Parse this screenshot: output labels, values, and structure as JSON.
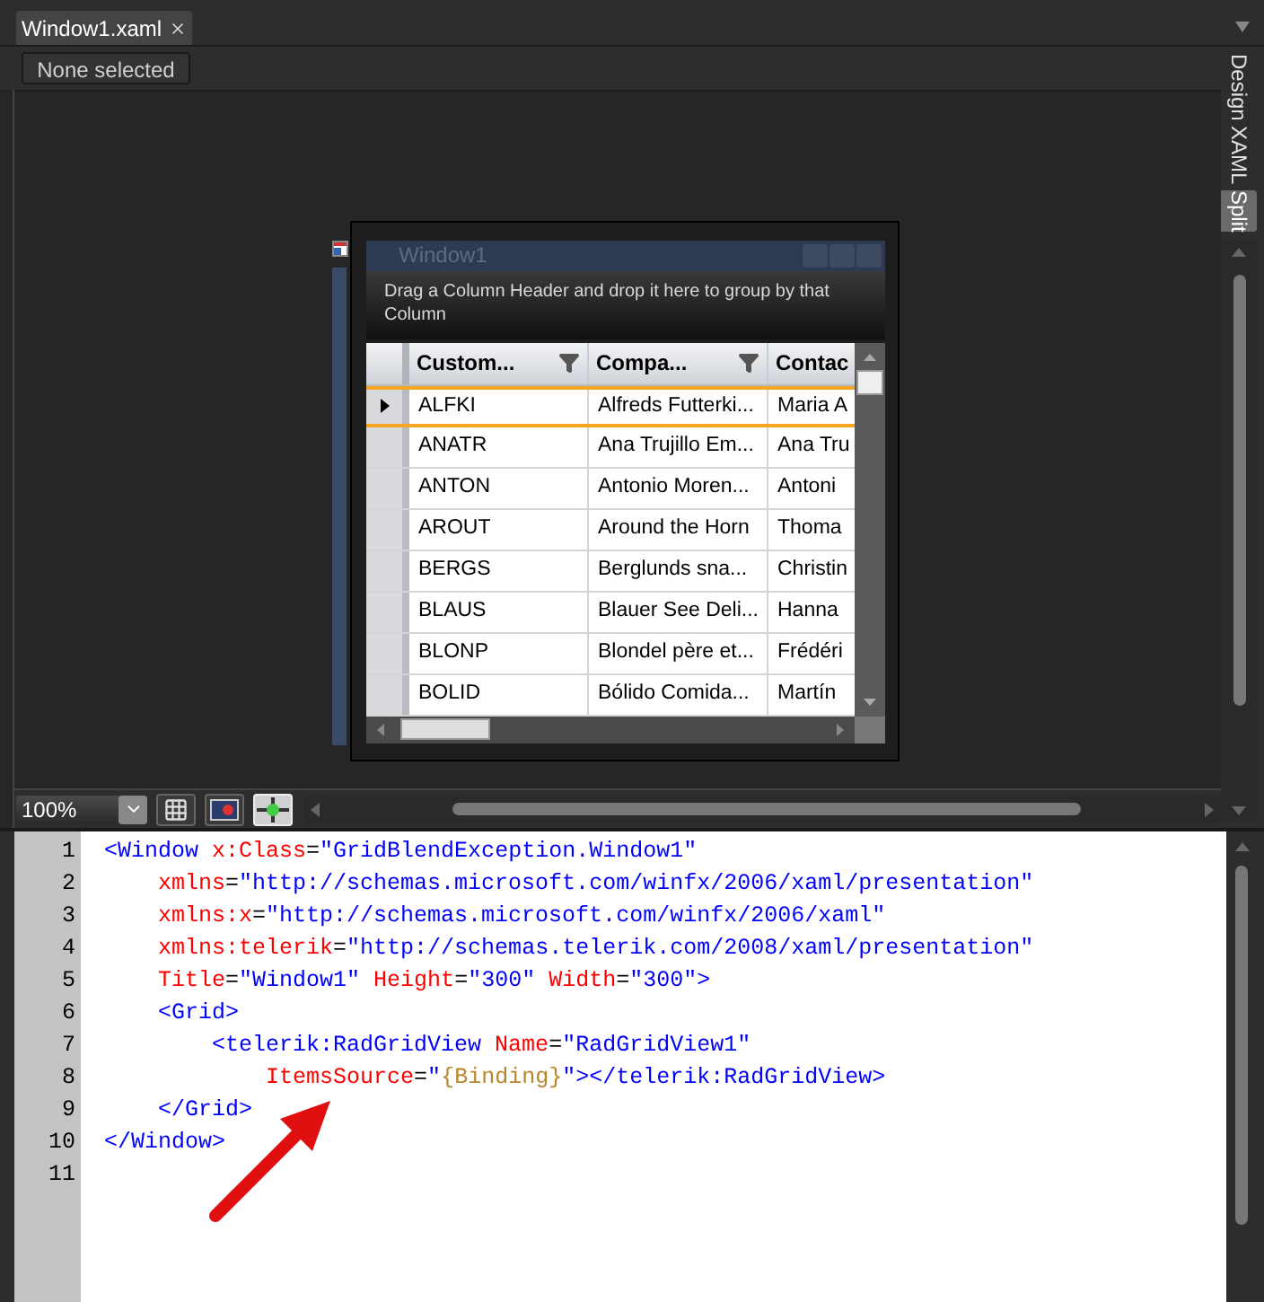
{
  "document_tab": {
    "title": "Window1.xaml"
  },
  "selection_button": {
    "label": "None selected"
  },
  "view_tabs": [
    {
      "label": "Design",
      "selected": false
    },
    {
      "label": "XAML",
      "selected": false
    },
    {
      "label": "Split",
      "selected": true
    }
  ],
  "preview": {
    "window_title": "Window1",
    "group_panel": "Drag a Column Header and drop it here to group by that Column",
    "columns": [
      {
        "header": "Custom...",
        "filter": true
      },
      {
        "header": "Compa...",
        "filter": true
      },
      {
        "header": "Contac",
        "filter": false
      }
    ],
    "rows": [
      {
        "cells": [
          "ALFKI",
          "Alfreds Futterki...",
          "Maria A"
        ],
        "current": true
      },
      {
        "cells": [
          "ANATR",
          "Ana Trujillo Em...",
          "Ana Tru"
        ],
        "current": false
      },
      {
        "cells": [
          "ANTON",
          "Antonio Moren...",
          "Antoni"
        ],
        "current": false
      },
      {
        "cells": [
          "AROUT",
          "Around the Horn",
          "Thoma"
        ],
        "current": false
      },
      {
        "cells": [
          "BERGS",
          "Berglunds sna...",
          "Christin"
        ],
        "current": false
      },
      {
        "cells": [
          "BLAUS",
          "Blauer See Deli...",
          "Hanna"
        ],
        "current": false
      },
      {
        "cells": [
          "BLONP",
          "Blondel père et...",
          "Frédéri"
        ],
        "current": false
      },
      {
        "cells": [
          "BOLID",
          "Bólido Comida...",
          "Martín"
        ],
        "current": false
      }
    ]
  },
  "zoom": {
    "value": "100%"
  },
  "view_buttons": [
    {
      "kind": "grid",
      "on": false
    },
    {
      "kind": "effects",
      "on": false
    },
    {
      "kind": "snap",
      "on": true
    }
  ],
  "code_lines": [
    {
      "number": "1",
      "tokens": [
        {
          "kind": "tag",
          "text": "<Window"
        },
        {
          "kind": "attr",
          "text": " x:Class"
        },
        {
          "kind": "punct",
          "text": "="
        },
        {
          "kind": "value",
          "text": "\"GridBlendException.Window1\""
        }
      ]
    },
    {
      "number": "2",
      "tokens": [
        {
          "kind": "attr",
          "text": "    xmlns"
        },
        {
          "kind": "punct",
          "text": "="
        },
        {
          "kind": "value",
          "text": "\"http://schemas.microsoft.com/winfx/2006/xaml/presentation\""
        }
      ]
    },
    {
      "number": "3",
      "tokens": [
        {
          "kind": "attr",
          "text": "    xmlns:x"
        },
        {
          "kind": "punct",
          "text": "="
        },
        {
          "kind": "value",
          "text": "\"http://schemas.microsoft.com/winfx/2006/xaml\""
        }
      ]
    },
    {
      "number": "4",
      "tokens": [
        {
          "kind": "attr",
          "text": "    xmlns:telerik"
        },
        {
          "kind": "punct",
          "text": "="
        },
        {
          "kind": "value",
          "text": "\"http://schemas.telerik.com/2008/xaml/presentation\""
        }
      ]
    },
    {
      "number": "5",
      "tokens": [
        {
          "kind": "attr",
          "text": "    Title"
        },
        {
          "kind": "punct",
          "text": "="
        },
        {
          "kind": "value",
          "text": "\"Window1\""
        },
        {
          "kind": "attr",
          "text": " Height"
        },
        {
          "kind": "punct",
          "text": "="
        },
        {
          "kind": "value",
          "text": "\"300\""
        },
        {
          "kind": "attr",
          "text": " Width"
        },
        {
          "kind": "punct",
          "text": "="
        },
        {
          "kind": "value",
          "text": "\"300\""
        },
        {
          "kind": "tag",
          "text": ">"
        }
      ]
    },
    {
      "number": "6",
      "tokens": [
        {
          "kind": "tag",
          "text": "    <Grid>"
        }
      ]
    },
    {
      "number": "7",
      "tokens": [
        {
          "kind": "tag",
          "text": "        <telerik:RadGridView"
        },
        {
          "kind": "attr",
          "text": " Name"
        },
        {
          "kind": "punct",
          "text": "="
        },
        {
          "kind": "value",
          "text": "\"RadGridView1\""
        }
      ]
    },
    {
      "number": "8",
      "tokens": [
        {
          "kind": "attr",
          "text": "            ItemsSource"
        },
        {
          "kind": "punct",
          "text": "="
        },
        {
          "kind": "value",
          "text": "\""
        },
        {
          "kind": "ext",
          "text": "{Binding}"
        },
        {
          "kind": "value",
          "text": "\""
        },
        {
          "kind": "tag",
          "text": "></telerik:RadGridView>"
        }
      ]
    },
    {
      "number": "9",
      "tokens": [
        {
          "kind": "tag",
          "text": "    </Grid>"
        }
      ]
    },
    {
      "number": "10",
      "tokens": [
        {
          "kind": "tag",
          "text": "</Window>"
        }
      ]
    },
    {
      "number": "11"
    }
  ]
}
